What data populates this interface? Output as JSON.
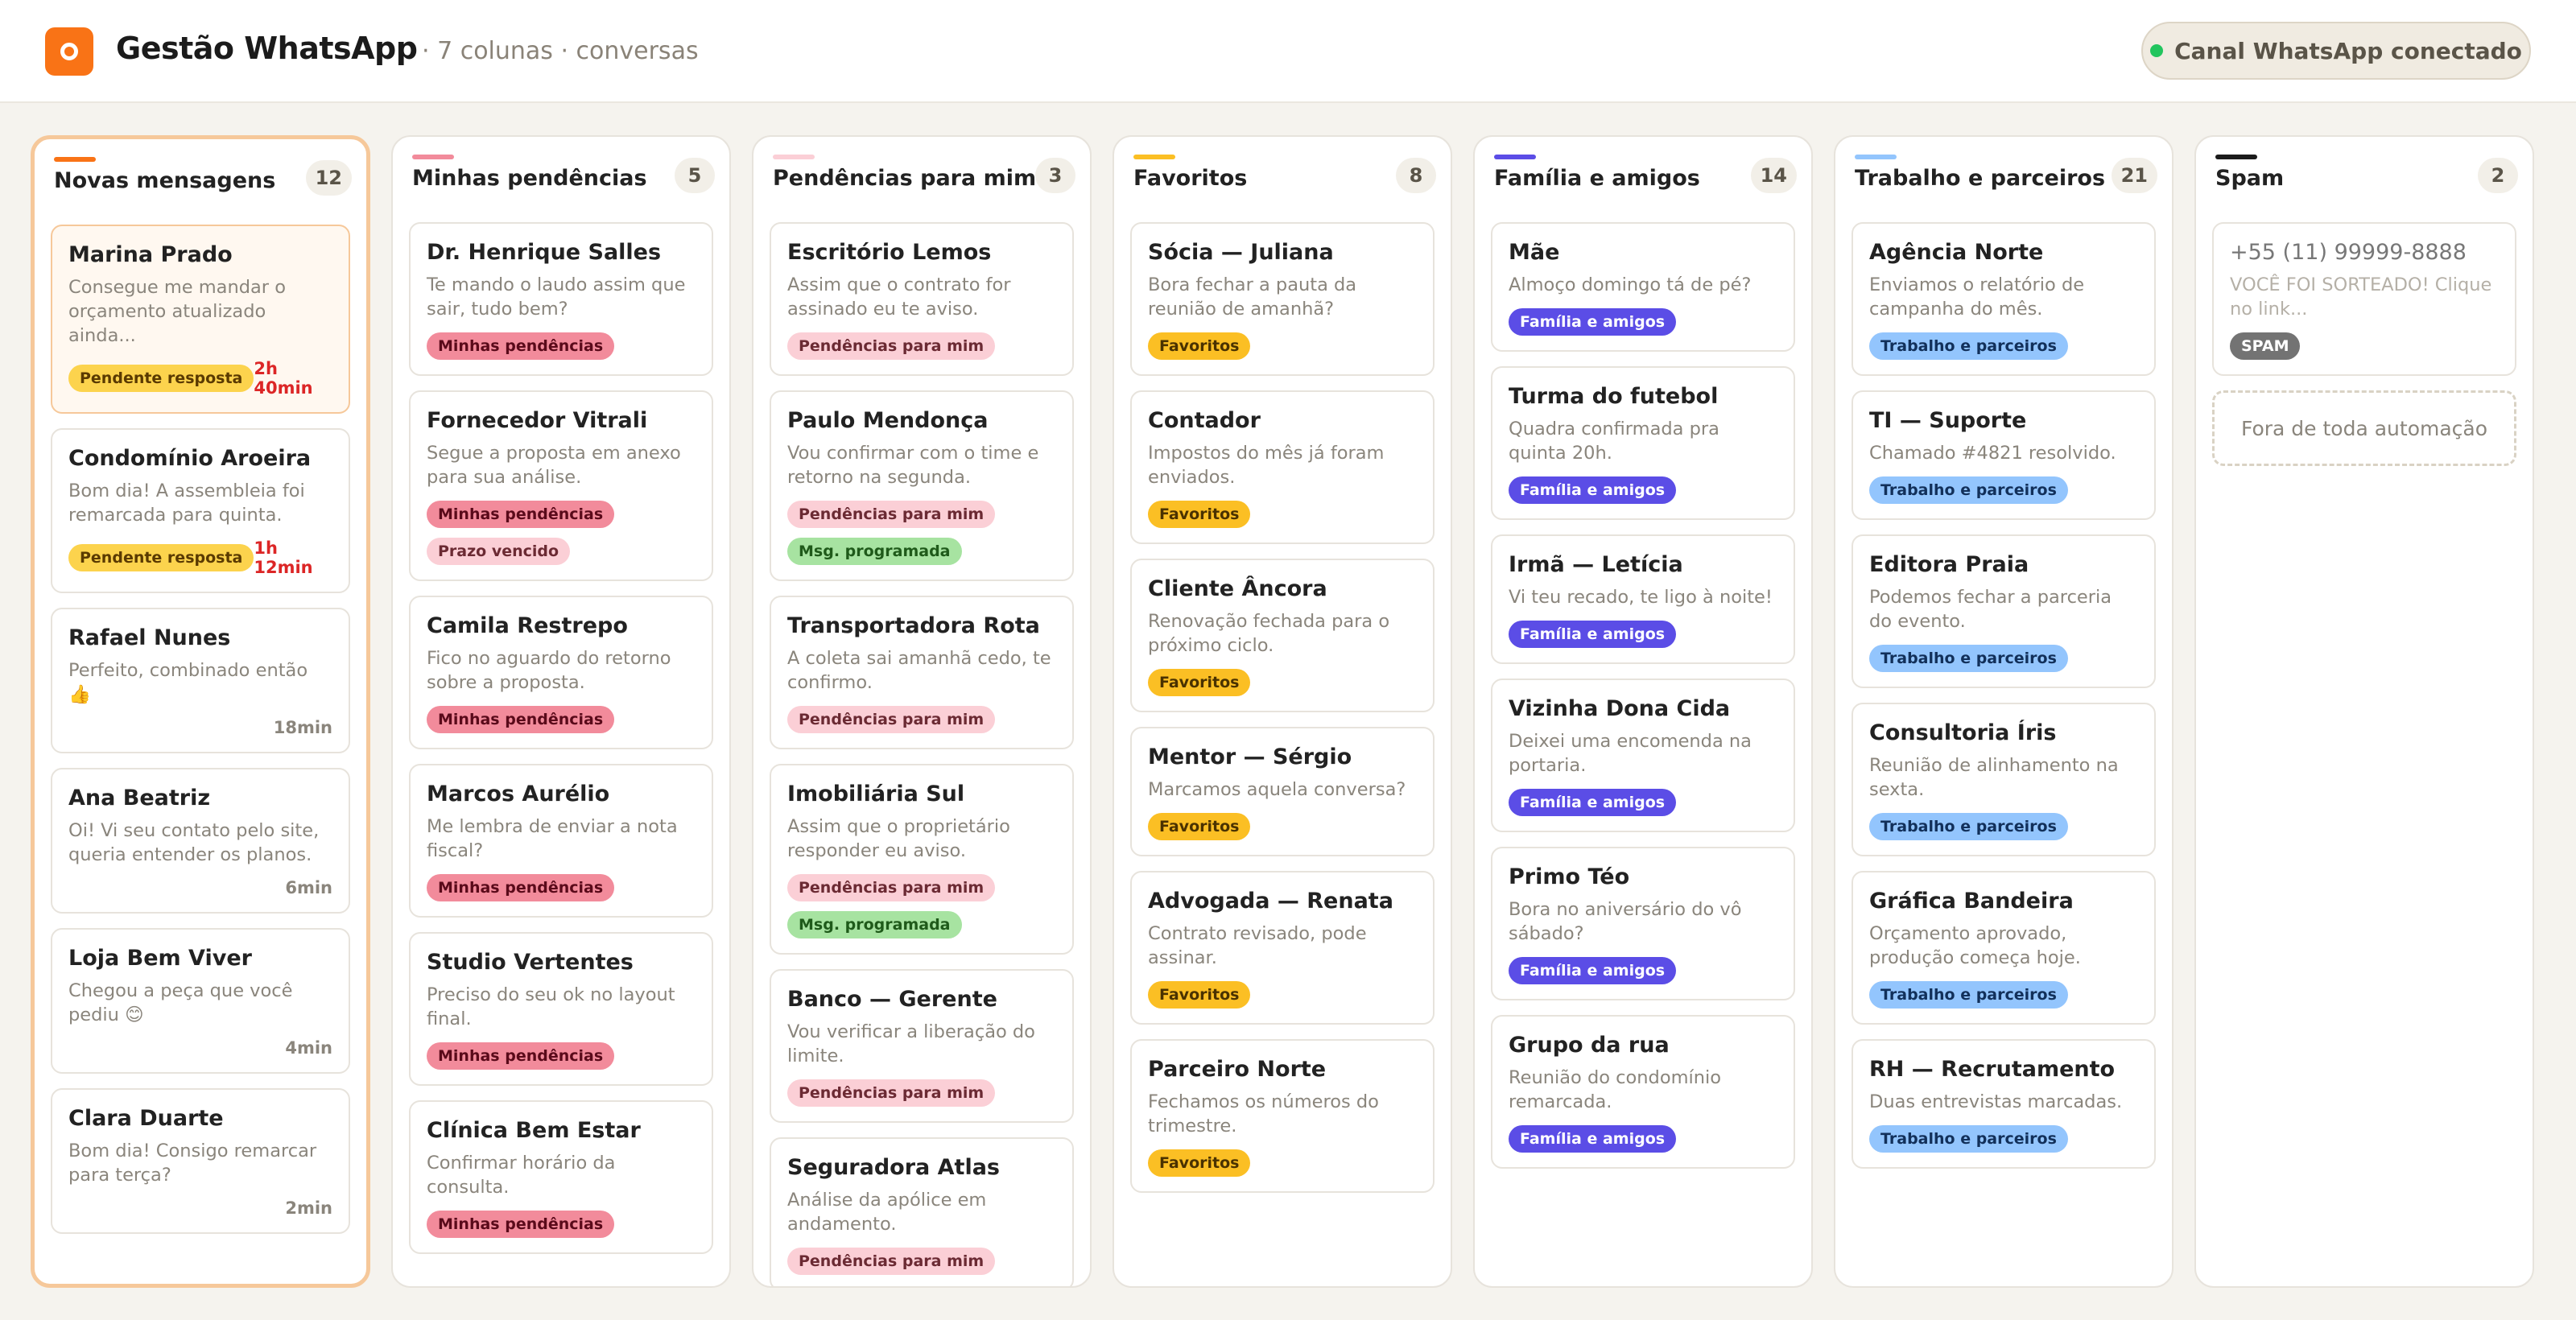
{
  "header": {
    "logo_letter": "O",
    "title": "Gestão WhatsApp",
    "subtitle": "· 7 colunas · conversas",
    "status": "Canal WhatsApp conectado",
    "status_color": "#22c55e"
  },
  "tag_styles": {
    "Pendente resposta": {
      "bg": "#fcd34d",
      "fg": "#5a3a00"
    },
    "Minhas pendências": {
      "bg": "#f28b9b",
      "fg": "#5a0a1a"
    },
    "Prazo vencido": {
      "bg": "#fbcfd6",
      "fg": "#6b2a33"
    },
    "Pendências para mim": {
      "bg": "#fbcfd6",
      "fg": "#6b2a33"
    },
    "Msg. programada": {
      "bg": "#a7e3a1",
      "fg": "#1f5a1a"
    },
    "Favoritos": {
      "bg": "#fbbf24",
      "fg": "#4a3200"
    },
    "Família e amigos": {
      "bg": "#5b4de6",
      "fg": "#ffffff"
    },
    "Trabalho e parceiros": {
      "bg": "#93c5fd",
      "fg": "#12305a"
    },
    "SPAM": {
      "bg": "#737373",
      "fg": "#ffffff"
    }
  },
  "columns": [
    {
      "title": "Novas mensagens",
      "count": "12",
      "accent": "#f97316",
      "active": true,
      "cards": [
        {
          "name": "Marina Prado",
          "preview": "Consegue me mandar o orçamento atualizado ainda...",
          "tags": [
            "Pendente resposta"
          ],
          "time": "2h 40min",
          "urgent": true,
          "highlight": true
        },
        {
          "name": "Condomínio Aroeira",
          "preview": "Bom dia! A assembleia foi remarcada para quinta.",
          "tags": [
            "Pendente resposta"
          ],
          "time": "1h 12min",
          "urgent": true
        },
        {
          "name": "Rafael Nunes",
          "preview": "Perfeito, combinado então 👍",
          "tags": [],
          "time": "18min"
        },
        {
          "name": "Ana Beatriz",
          "preview": "Oi! Vi seu contato pelo site, queria entender os planos.",
          "tags": [],
          "time": "6min"
        },
        {
          "name": "Loja Bem Viver",
          "preview": "Chegou a peça que você pediu 😊",
          "tags": [],
          "time": "4min"
        },
        {
          "name": "Clara Duarte",
          "preview": "Bom dia! Consigo remarcar para terça?",
          "tags": [],
          "time": "2min"
        }
      ]
    },
    {
      "title": "Minhas pendências",
      "count": "5",
      "accent": "#f28b9b",
      "cards": [
        {
          "name": "Dr. Henrique Salles",
          "preview": "Te mando o laudo assim que sair, tudo bem?",
          "tags": [
            "Minhas pendências"
          ]
        },
        {
          "name": "Fornecedor Vitrali",
          "preview": "Segue a proposta em anexo para sua análise.",
          "tags": [
            "Minhas pendências",
            "Prazo vencido"
          ]
        },
        {
          "name": "Camila Restrepo",
          "preview": "Fico no aguardo do retorno sobre a proposta.",
          "tags": [
            "Minhas pendências"
          ]
        },
        {
          "name": "Marcos Aurélio",
          "preview": "Me lembra de enviar a nota fiscal?",
          "tags": [
            "Minhas pendências"
          ]
        },
        {
          "name": "Studio Vertentes",
          "preview": "Preciso do seu ok no layout final.",
          "tags": [
            "Minhas pendências"
          ]
        },
        {
          "name": "Clínica Bem Estar",
          "preview": "Confirmar horário da consulta.",
          "tags": [
            "Minhas pendências"
          ]
        }
      ]
    },
    {
      "title": "Pendências para mim",
      "count": "3",
      "accent": "#fbcfd6",
      "cards": [
        {
          "name": "Escritório Lemos",
          "preview": "Assim que o contrato for assinado eu te aviso.",
          "tags": [
            "Pendências para mim"
          ]
        },
        {
          "name": "Paulo Mendonça",
          "preview": "Vou confirmar com o time e retorno na segunda.",
          "tags": [
            "Pendências para mim",
            "Msg. programada"
          ]
        },
        {
          "name": "Transportadora Rota",
          "preview": "A coleta sai amanhã cedo, te confirmo.",
          "tags": [
            "Pendências para mim"
          ]
        },
        {
          "name": "Imobiliária Sul",
          "preview": "Assim que o proprietário responder eu aviso.",
          "tags": [
            "Pendências para mim",
            "Msg. programada"
          ]
        },
        {
          "name": "Banco — Gerente",
          "preview": "Vou verificar a liberação do limite.",
          "tags": [
            "Pendências para mim"
          ]
        },
        {
          "name": "Seguradora Atlas",
          "preview": "Análise da apólice em andamento.",
          "tags": [
            "Pendências para mim"
          ]
        }
      ]
    },
    {
      "title": "Favoritos",
      "count": "8",
      "accent": "#fbbf24",
      "cards": [
        {
          "name": "Sócia — Juliana",
          "preview": "Bora fechar a pauta da reunião de amanhã?",
          "tags": [
            "Favoritos"
          ]
        },
        {
          "name": "Contador",
          "preview": "Impostos do mês já foram enviados.",
          "tags": [
            "Favoritos"
          ]
        },
        {
          "name": "Cliente Âncora",
          "preview": "Renovação fechada para o próximo ciclo.",
          "tags": [
            "Favoritos"
          ]
        },
        {
          "name": "Mentor — Sérgio",
          "preview": "Marcamos aquela conversa?",
          "tags": [
            "Favoritos"
          ]
        },
        {
          "name": "Advogada — Renata",
          "preview": "Contrato revisado, pode assinar.",
          "tags": [
            "Favoritos"
          ]
        },
        {
          "name": "Parceiro Norte",
          "preview": "Fechamos os números do trimestre.",
          "tags": [
            "Favoritos"
          ]
        }
      ]
    },
    {
      "title": "Família e amigos",
      "count": "14",
      "accent": "#5b4de6",
      "cards": [
        {
          "name": "Mãe",
          "preview": "Almoço domingo tá de pé?",
          "tags": [
            "Família e amigos"
          ]
        },
        {
          "name": "Turma do futebol",
          "preview": "Quadra confirmada pra quinta 20h.",
          "tags": [
            "Família e amigos"
          ]
        },
        {
          "name": "Irmã — Letícia",
          "preview": "Vi teu recado, te ligo à noite!",
          "tags": [
            "Família e amigos"
          ]
        },
        {
          "name": "Vizinha Dona Cida",
          "preview": "Deixei uma encomenda na portaria.",
          "tags": [
            "Família e amigos"
          ]
        },
        {
          "name": "Primo Téo",
          "preview": "Bora no aniversário do vô sábado?",
          "tags": [
            "Família e amigos"
          ]
        },
        {
          "name": "Grupo da rua",
          "preview": "Reunião do condomínio remarcada.",
          "tags": [
            "Família e amigos"
          ]
        }
      ]
    },
    {
      "title": "Trabalho e parceiros",
      "count": "21",
      "accent": "#93c5fd",
      "cards": [
        {
          "name": "Agência Norte",
          "preview": "Enviamos o relatório de campanha do mês.",
          "tags": [
            "Trabalho e parceiros"
          ]
        },
        {
          "name": "TI — Suporte",
          "preview": "Chamado #4821 resolvido.",
          "tags": [
            "Trabalho e parceiros"
          ]
        },
        {
          "name": "Editora Praia",
          "preview": "Podemos fechar a parceria do evento.",
          "tags": [
            "Trabalho e parceiros"
          ]
        },
        {
          "name": "Consultoria Íris",
          "preview": "Reunião de alinhamento na sexta.",
          "tags": [
            "Trabalho e parceiros"
          ]
        },
        {
          "name": "Gráfica Bandeira",
          "preview": "Orçamento aprovado, produção começa hoje.",
          "tags": [
            "Trabalho e parceiros"
          ]
        },
        {
          "name": "RH — Recrutamento",
          "preview": "Duas entrevistas marcadas.",
          "tags": [
            "Trabalho e parceiros"
          ]
        }
      ]
    },
    {
      "title": "Spam",
      "count": "2",
      "accent": "#1b1b1b",
      "cards": [
        {
          "name": "+55 (11) 99999-8888",
          "preview": "VOCÊ FOI SORTEADO! Clique no link...",
          "tags": [
            "SPAM"
          ],
          "muted": true
        }
      ],
      "placeholder": "Fora de toda automação"
    }
  ]
}
